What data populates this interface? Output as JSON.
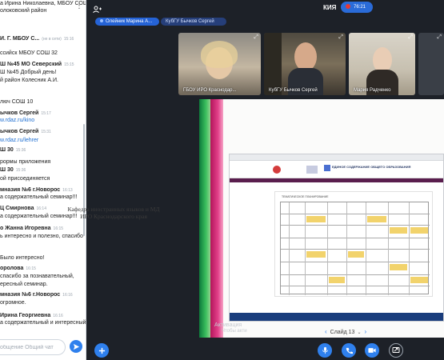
{
  "chat": {
    "menu_glyph": "⋮",
    "messages": [
      {
        "text": "а Ирина Николаевна, МБОУ СОШ",
        "time": ""
      },
      {
        "text": "олоковский район",
        "time": ""
      },
      {
        "author": "И. Г. МБОУ С...",
        "pm": "(не в сети)",
        "time": "15:16"
      },
      {
        "text": "ссийск МБОУ СОШ 32",
        "time": ""
      },
      {
        "author": "Ш №45 МО Северский",
        "time": "15:15"
      },
      {
        "text": "Ш №45 Добрый день!",
        "time": ""
      },
      {
        "text": "й район Колесник А.И.",
        "time": ""
      },
      {
        "text": "люч СОШ 10",
        "time": ""
      },
      {
        "author": "ычков Сергей",
        "time": "15:17"
      },
      {
        "link": "w.rdaz.ru/kino",
        "time": ""
      },
      {
        "author": "ычков Сергей",
        "time": "15:31"
      },
      {
        "link": "w.rdaz.ru/lehrer",
        "time": ""
      },
      {
        "author": "Ш 30",
        "time": "15:36"
      },
      {
        "text": "рормы приложения",
        "time": ""
      },
      {
        "author": "Ш 30",
        "time": "15:36"
      },
      {
        "text": "ой присоединяется",
        "time": ""
      },
      {
        "author": "мназия №6 г.Новорос",
        "time": "16:13"
      },
      {
        "text": "а содержательный семинар!!!",
        "time": ""
      },
      {
        "author": "Ц Смирнова",
        "time": "16:14"
      },
      {
        "text": "а содержательный семинар!!!",
        "time": ""
      },
      {
        "author": "о Жанна Игоревна",
        "time": "16:15"
      },
      {
        "text": "ь интересно и полезно, спасибо",
        "time": ""
      },
      {
        "text": "Было интересно!",
        "time": ""
      },
      {
        "author": "оролова",
        "time": "16:15"
      },
      {
        "text": "спасибо за познавательный,",
        "time": ""
      },
      {
        "text": "ересный семинар.",
        "time": ""
      },
      {
        "author": "мназия №6 г.Новорос",
        "time": "16:16"
      },
      {
        "text": "огромное.",
        "time": ""
      },
      {
        "author": "Ирина Георгиевна",
        "time": "16:16"
      },
      {
        "text": "а содержательный и интересный",
        "time": ""
      }
    ],
    "input_placeholder": "общение Общий чат"
  },
  "topbar": {
    "participants_pill": "Олейник Марина А...",
    "second_pill": "КубГУ Бычков Сергей",
    "room_name": "КИЯ",
    "timer": "76:21"
  },
  "tiles": [
    {
      "caption": "ГБОУ ИРО Краснодар..."
    },
    {
      "caption": "КубГУ Бычков Сергей"
    },
    {
      "caption": "Мария Радченко"
    },
    {
      "caption": ""
    }
  ],
  "screen": {
    "caption_line1": "Кафедра иностранных языков и МД",
    "caption_line2": "ИРО Краснодарского края",
    "slide_label": "Слайд 13",
    "watermark_line1": "Активация",
    "watermark_line2": "Чтобы акти",
    "site_logo": "ЕДИНОЕ СОДЕРЖАНИЕ ОБЩЕГО ОБРАЗОВАНИЯ",
    "doc_title": "ТЕМАТИЧЕСКОЕ ПЛАНИРОВАНИЕ"
  },
  "colors": {
    "accent": "#2f80ed",
    "background": "#1d2128",
    "record": "#e53935"
  },
  "icons": {
    "participants": "people-icon",
    "add": "plus-icon",
    "mic": "microphone-icon",
    "phone": "phone-icon",
    "camera": "camera-icon",
    "share": "screen-share-icon",
    "send": "send-icon"
  }
}
